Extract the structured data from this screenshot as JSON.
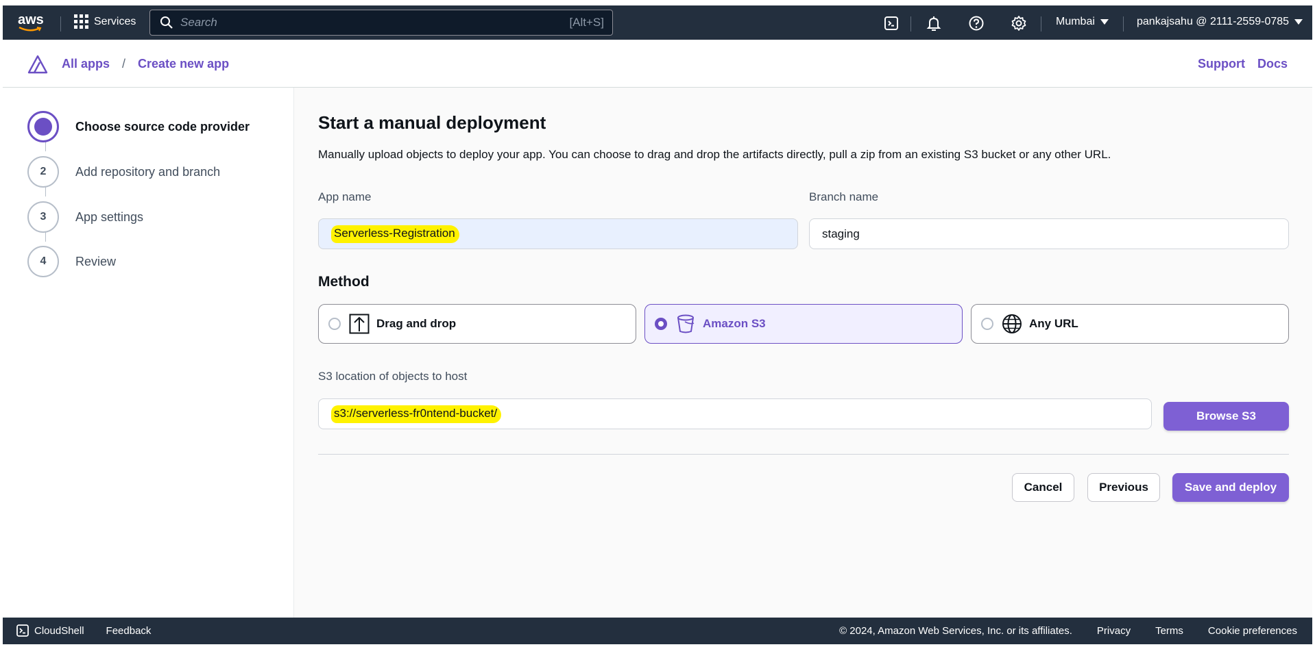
{
  "topnav": {
    "logo_text": "aws",
    "services_label": "Services",
    "search_placeholder": "Search",
    "search_shortcut": "[Alt+S]",
    "region": "Mumbai",
    "account": "pankajsahu @ 2111-2559-0785"
  },
  "header": {
    "breadcrumbs": [
      "All apps",
      "Create new app"
    ],
    "separator": "/",
    "support": "Support",
    "docs": "Docs"
  },
  "steps": [
    {
      "label": "Choose source code provider",
      "number": "1",
      "active": true
    },
    {
      "label": "Add repository and branch",
      "number": "2",
      "active": false
    },
    {
      "label": "App settings",
      "number": "3",
      "active": false
    },
    {
      "label": "Review",
      "number": "4",
      "active": false
    }
  ],
  "main": {
    "title": "Start a manual deployment",
    "description": "Manually upload objects to deploy your app. You can choose to drag and drop the artifacts directly, pull a zip from an existing S3 bucket or any other URL.",
    "app_name_label": "App name",
    "app_name_value": "Serverless-Registration",
    "branch_name_label": "Branch name",
    "branch_name_value": "staging",
    "method_title": "Method",
    "methods": [
      {
        "label": "Drag and drop",
        "icon": "upload-icon",
        "selected": false
      },
      {
        "label": "Amazon S3",
        "icon": "bucket-icon",
        "selected": true
      },
      {
        "label": "Any URL",
        "icon": "globe-icon",
        "selected": false
      }
    ],
    "s3_label": "S3 location of objects to host",
    "s3_value": "s3://serverless-fr0ntend-bucket/",
    "browse_s3": "Browse S3",
    "cancel": "Cancel",
    "previous": "Previous",
    "save_deploy": "Save and deploy"
  },
  "footer": {
    "cloudshell": "CloudShell",
    "feedback": "Feedback",
    "copyright": "© 2024, Amazon Web Services, Inc. or its affiliates.",
    "privacy": "Privacy",
    "terms": "Terms",
    "cookies": "Cookie preferences"
  },
  "colors": {
    "nav_bg": "#232f3e",
    "accent": "#6b4fc4",
    "primary_button": "#7e60d4",
    "highlight": "#fff200"
  }
}
